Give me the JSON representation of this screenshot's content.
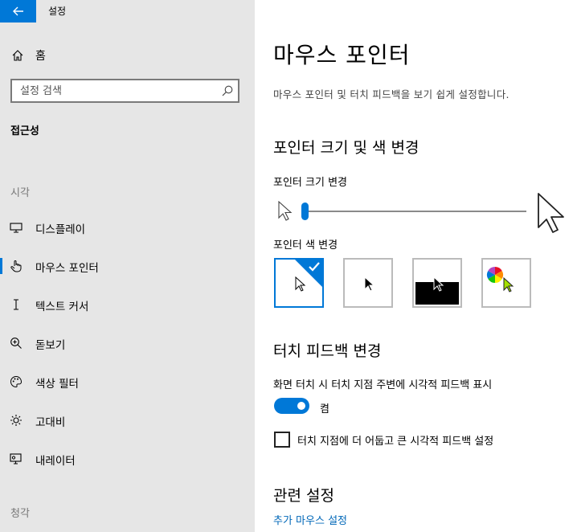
{
  "app": {
    "title": "설정"
  },
  "sidebar": {
    "home_label": "홈",
    "search_placeholder": "설정 검색",
    "section_title": "접근성",
    "groups": [
      {
        "label": "시각",
        "items": [
          {
            "label": "디스플레이",
            "icon": "monitor-icon"
          },
          {
            "label": "마우스 포인터",
            "icon": "hand-pointer-icon",
            "active": true
          },
          {
            "label": "텍스트 커서",
            "icon": "text-cursor-icon"
          },
          {
            "label": "돋보기",
            "icon": "magnifier-icon"
          },
          {
            "label": "색상 필터",
            "icon": "palette-icon"
          },
          {
            "label": "고대비",
            "icon": "brightness-icon"
          },
          {
            "label": "내레이터",
            "icon": "narrator-icon"
          }
        ]
      },
      {
        "label": "청각",
        "items": []
      }
    ]
  },
  "main": {
    "title": "마우스 포인터",
    "description": "마우스 포인터 및 터치 피드백을 보기 쉽게 설정합니다.",
    "pointer_section": {
      "heading": "포인터 크기 및 색 변경",
      "size_label": "포인터 크기 변경",
      "size_value": 1,
      "color_label": "포인터 색 변경",
      "color_options": [
        {
          "name": "white",
          "selected": true
        },
        {
          "name": "black",
          "selected": false
        },
        {
          "name": "inverted",
          "selected": false
        },
        {
          "name": "custom",
          "selected": false
        }
      ]
    },
    "touch_section": {
      "heading": "터치 피드백 변경",
      "toggle_label": "화면 터치 시 터치 지점 주변에 시각적 피드백 표시",
      "toggle_state": "켬",
      "checkbox_label": "터치 지점에 더 어둡고 큰 시각적 피드백 설정"
    },
    "related": {
      "heading": "관련 설정",
      "link": "추가 마우스 설정"
    }
  },
  "colors": {
    "accent": "#0078d7",
    "sidebar_bg": "#e6e6e6",
    "link": "#0067b8"
  }
}
